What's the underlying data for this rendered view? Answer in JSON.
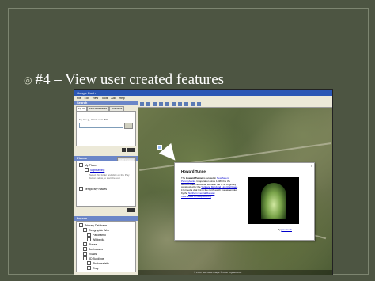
{
  "slide": {
    "bullet_icon": "circle-bullet-icon",
    "title": "#4 – View user created features"
  },
  "window": {
    "title": "Google Earth",
    "menu": [
      "File",
      "Edit",
      "View",
      "Tools",
      "Add",
      "Help"
    ]
  },
  "search": {
    "header": "Search",
    "tabs": [
      "Fly To",
      "Find Businesses",
      "Directions"
    ],
    "label": "Fly to e.g., Hotels near JFK",
    "placeholder": ""
  },
  "places": {
    "header": "Places",
    "add_content": "Add Content",
    "items": [
      "My Places",
      "Sightseeing",
      "Temporary Places"
    ],
    "note": "Select this folder and click on the Play button below, to start the tour."
  },
  "layers": {
    "header": "Layers",
    "items": [
      "Primary Database",
      "Geographic Web",
      "Panoramio",
      "Wikipedia",
      "Places",
      "Businesses",
      "Roads",
      "3D Buildings",
      "Photorealistic",
      "Gray"
    ]
  },
  "callout": {
    "title": "Howard Tunnel",
    "text_pre": "The ",
    "name": "Howard Tunnel",
    "text_1": " is located in ",
    "link_1": "New Salem, Pennsylvania",
    "text_2": ". In operation since 1838, this the second oldest active rail tunnel in the U.S. Originally constructed by the ",
    "link_2": "York and Maryland Line Rail Road",
    "text_3": ", it formed a vital link in the north-south line assembled by the ",
    "link_3": "Northern Central Railway",
    "text_4": ".",
    "link_4": "View article on wikipedia.org",
    "credit_pre": "By ",
    "credit_link": "jasonnoffs",
    "close": "x"
  },
  "status": {
    "text": "© 2008 Tele Atlas   Image © 2008 DigitalGlobe"
  }
}
